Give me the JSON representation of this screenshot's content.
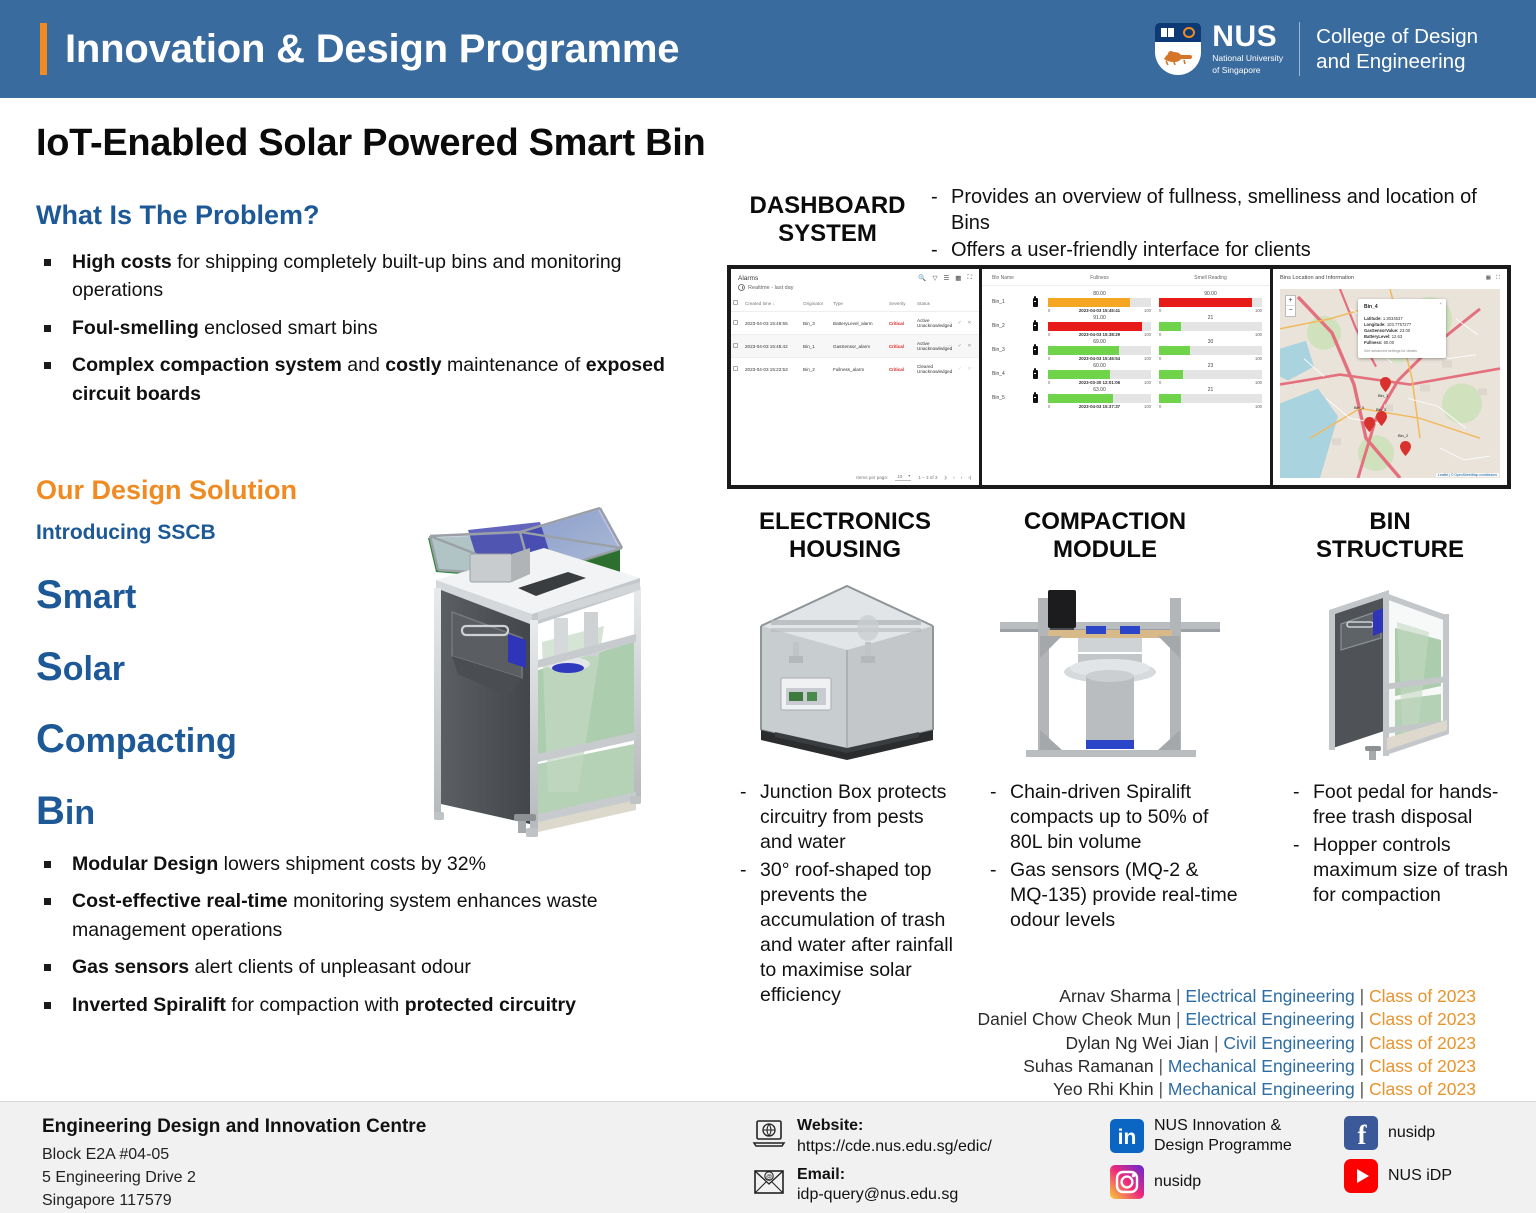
{
  "header": {
    "title": "Innovation & Design Programme",
    "logo": {
      "wordmark": "NUS",
      "sub_line1": "National University",
      "sub_line2": "of Singapore",
      "faculty_line1": "College of Design",
      "faculty_line2": "and Engineering"
    },
    "accent_color": "#ef8b22",
    "bg_color": "#3a6b9e"
  },
  "poster": {
    "title": "IoT-Enabled Solar Powered Smart Bin"
  },
  "problem": {
    "heading": "What Is The Problem?",
    "bullets": [
      {
        "bold1": "High costs",
        "rest1": " for shipping completely built-up bins and monitoring operations"
      },
      {
        "bold1": "Foul-smelling",
        "rest1": " enclosed smart bins"
      },
      {
        "bold1": "Complex compaction system",
        "rest1": " and ",
        "bold2": "costly",
        "rest2": " maintenance of ",
        "bold3": "exposed circuit boards"
      }
    ]
  },
  "solution": {
    "heading": "Our Design Solution",
    "intro": "Introducing SSCB",
    "acronym": [
      {
        "cap": "S",
        "rest": "mart"
      },
      {
        "cap": "S",
        "rest": "olar"
      },
      {
        "cap": "C",
        "rest": "ompacting"
      },
      {
        "cap": "B",
        "rest": "in"
      }
    ],
    "bullets": [
      {
        "bold1": "Modular Design",
        "rest1": " lowers shipment costs by 32%"
      },
      {
        "bold1": "Cost-effective real-time",
        "rest1": " monitoring system enhances waste management operations"
      },
      {
        "bold1": "Gas sensors",
        "rest1": " alert clients of unpleasant odour"
      },
      {
        "bold1": "Inverted Spiralift",
        "rest1": " for compaction with ",
        "bold2": "protected circuitry"
      }
    ]
  },
  "dashboard": {
    "heading_line1": "DASHBOARD",
    "heading_line2": "SYSTEM",
    "notes": [
      "Provides an overview of fullness, smelliness and location of Bins",
      "Offers a user-friendly interface for clients"
    ],
    "alarms_panel": {
      "title": "Alarms",
      "subtitle": "Realtime - last day",
      "toolbar_icons": [
        "search-icon",
        "filter-icon",
        "columns-icon",
        "device-icon",
        "fullscreen-icon"
      ],
      "columns": [
        "Created time",
        "Originator",
        "Type",
        "Severity",
        "Status"
      ],
      "rows": [
        {
          "created": "2023-04-03 15:46:55",
          "originator": "Bin_3",
          "type": "BatteryLevel_alarm",
          "severity": "Critical",
          "status_l1": "Active",
          "status_l2": "Unacknowledged"
        },
        {
          "created": "2023-04-03 15:45:42",
          "originator": "Bin_1",
          "type": "GasSensor_alarm",
          "severity": "Critical",
          "status_l1": "Active",
          "status_l2": "Unacknowledged"
        },
        {
          "created": "2023-04-03 15:22:53",
          "originator": "Bin_2",
          "type": "Fullness_alarm",
          "severity": "Critical",
          "status_l1": "Cleared",
          "status_l2": "Unacknowledged"
        }
      ],
      "items_per_page_label": "Items per page:",
      "items_per_page_value": "10",
      "range_label": "1 – 3 of 3"
    },
    "bins_panel": {
      "columns": [
        "Bin Name",
        "Fullness",
        "Smell Reading"
      ],
      "axis_min": "0",
      "axis_max": "100",
      "rows": [
        {
          "name": "Bin_1",
          "fullness": "80.00",
          "fullness_pct": 80,
          "fullness_color": "#f5a623",
          "timestamp": "2023-04-03 15:45:41",
          "smell": "90.00",
          "smell_pct": 90,
          "smell_color": "#e81b1b"
        },
        {
          "name": "Bin_2",
          "fullness": "91.00",
          "fullness_pct": 91,
          "fullness_color": "#e81b1b",
          "timestamp": "2023-04-03 15:38:29",
          "smell": "21",
          "smell_pct": 21,
          "smell_color": "#6fd44a"
        },
        {
          "name": "Bin_3",
          "fullness": "69.00",
          "fullness_pct": 69,
          "fullness_color": "#6fd44a",
          "timestamp": "2023-04-03 15:46:54",
          "smell": "30",
          "smell_pct": 30,
          "smell_color": "#6fd44a"
        },
        {
          "name": "Bin_4",
          "fullness": "60.00",
          "fullness_pct": 60,
          "fullness_color": "#6fd44a",
          "timestamp": "2023-03-30 12:01:06",
          "smell": "23",
          "smell_pct": 23,
          "smell_color": "#6fd44a"
        },
        {
          "name": "Bin_5",
          "fullness": "63.00",
          "fullness_pct": 63,
          "fullness_color": "#6fd44a",
          "timestamp": "2023-04-03 15:37:37",
          "smell": "21",
          "smell_pct": 21,
          "smell_color": "#6fd44a"
        }
      ]
    },
    "map_panel": {
      "title": "Bins Location and Information",
      "zoom_in": "+",
      "zoom_out": "−",
      "popup": {
        "bin": "Bin_4",
        "latitude_label": "Latitude:",
        "latitude": "1.3034537",
        "longitude_label": "Longitude:",
        "longitude": "103.7757277",
        "gas_label": "GasSensorValue:",
        "gas": "23.00",
        "battery_label": "BatteryLevel:",
        "battery": "12.63",
        "fullness_label": "Fullness:",
        "fullness": "60.00",
        "note": "See advanced settings for details",
        "close": "×"
      },
      "pin_labels": [
        "Bin_1",
        "Bin_5",
        "Bin_3",
        "Bin_2"
      ],
      "attribution": "Leaflet | © OpenStreetMap contributors"
    }
  },
  "modules": [
    {
      "title_line1": "ELECTRONICS",
      "title_line2": "HOUSING",
      "notes": [
        "Junction Box protects circuitry from pests and water",
        "30° roof-shaped top prevents the accumulation of trash and water after rainfall to maximise solar efficiency"
      ]
    },
    {
      "title_line1": "COMPACTION",
      "title_line2": "MODULE",
      "notes": [
        "Chain-driven Spiralift compacts up to 50% of 80L bin volume",
        "Gas sensors (MQ-2 & MQ-135) provide real-time odour levels"
      ]
    },
    {
      "title_line1": "BIN",
      "title_line2": "STRUCTURE",
      "notes": [
        "Foot pedal for hands-free trash disposal",
        "Hopper controls maximum size of trash for compaction"
      ]
    }
  ],
  "credits": {
    "separator": "|",
    "members": [
      {
        "name": "Arnav Sharma",
        "discipline": "Electrical Engineering",
        "year": "Class of 2023"
      },
      {
        "name": "Daniel Chow Cheok Mun",
        "discipline": "Electrical Engineering",
        "year": "Class of 2023"
      },
      {
        "name": "Dylan Ng Wei Jian",
        "discipline": "Civil Engineering",
        "year": "Class of 2023"
      },
      {
        "name": "Suhas Ramanan",
        "discipline": "Mechanical Engineering",
        "year": "Class of 2023"
      },
      {
        "name": "Yeo Rhi Khin",
        "discipline": "Mechanical Engineering",
        "year": "Class of 2023"
      }
    ]
  },
  "footer": {
    "org": "Engineering Design and Innovation Centre",
    "address_line1": "Block E2A #04-05",
    "address_line2": "5 Engineering Drive 2",
    "address_line3": "Singapore 117579",
    "website_label": "Website:",
    "website_value": "https://cde.nus.edu.sg/edic/",
    "email_label": "Email:",
    "email_value": "idp-query@nus.edu.sg",
    "linkedin_line1": "NUS Innovation &",
    "linkedin_line2": "Design Programme",
    "instagram": "nusidp",
    "facebook": "nusidp",
    "youtube": "NUS iDP"
  }
}
